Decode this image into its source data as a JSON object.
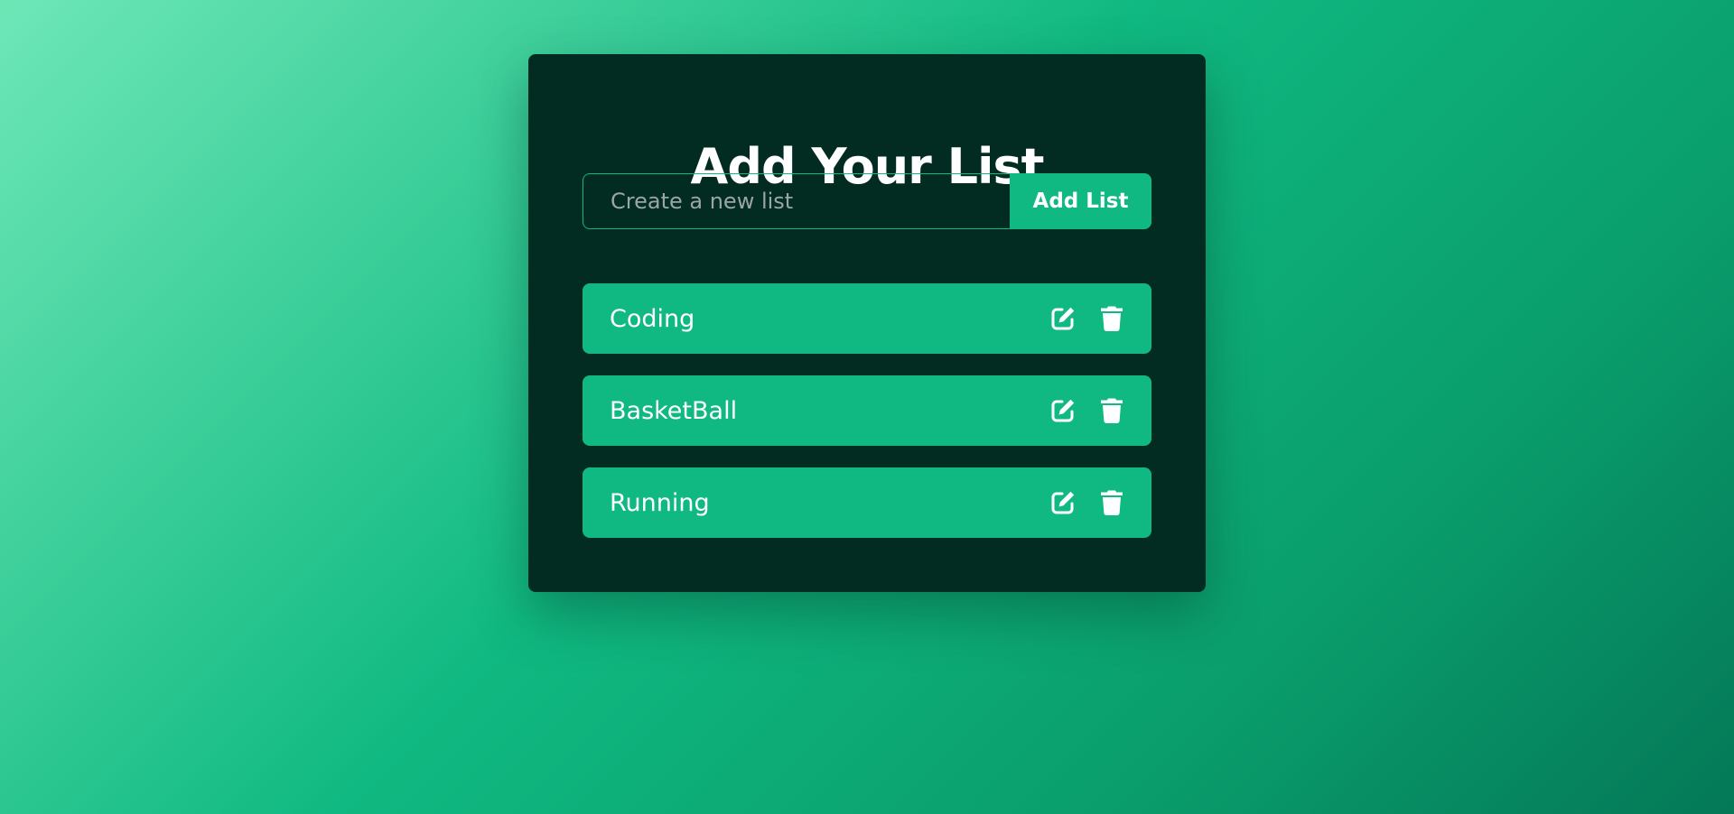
{
  "app": {
    "title": "Add Your List"
  },
  "form": {
    "input_value": "",
    "input_placeholder": "Create a new list",
    "add_button_label": "Add List"
  },
  "lists": [
    {
      "label": "Coding",
      "edit_icon": "edit-icon",
      "delete_icon": "trash-icon"
    },
    {
      "label": "BasketBall",
      "edit_icon": "edit-icon",
      "delete_icon": "trash-icon"
    },
    {
      "label": "Running",
      "edit_icon": "edit-icon",
      "delete_icon": "trash-icon"
    }
  ],
  "colors": {
    "card_background": "#022c22",
    "accent": "#10b981",
    "text": "#ffffff"
  }
}
